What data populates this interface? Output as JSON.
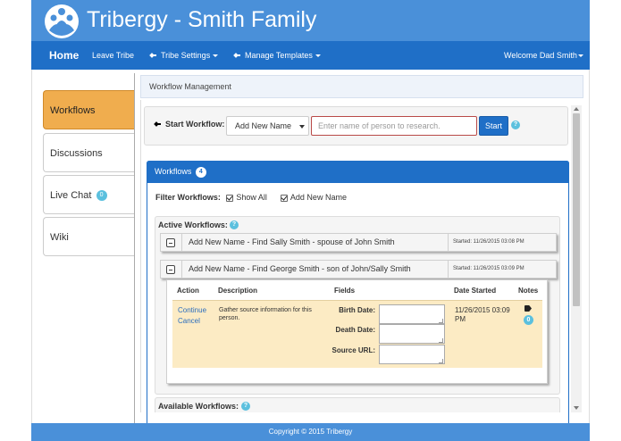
{
  "brand": {
    "title": "Tribergy - Smith Family",
    "logo_icon": "family-group-icon"
  },
  "colors": {
    "brand_bar": "#4a90d9",
    "navbar": "#1f6fc7",
    "active_tab": "#f0ad4e",
    "badge": "#5bc0de",
    "task_highlight": "#fcebc4",
    "link": "#2a6dbd"
  },
  "nav": {
    "home": "Home",
    "leave_tribe": "Leave Tribe",
    "tribe_settings": "Tribe Settings",
    "manage_templates": "Manage Templates",
    "welcome": "Welcome Dad Smith"
  },
  "sidebar": {
    "items": [
      {
        "label": "Workflows",
        "active": true
      },
      {
        "label": "Discussions",
        "active": false
      },
      {
        "label": "Live Chat",
        "badge": "0",
        "active": false
      },
      {
        "label": "Wiki",
        "active": false
      }
    ]
  },
  "content": {
    "header": "Workflow Management"
  },
  "start_workflow": {
    "label": "Start Workflow:",
    "selected": "Add New Name",
    "placeholder": "Enter name of person to research.",
    "button": "Start",
    "help": "?"
  },
  "workflows": {
    "title": "Workflows",
    "count": "4",
    "filter_label": "Filter Workflows:",
    "filters": [
      {
        "label": "Show All",
        "checked": true
      },
      {
        "label": "Add New Name",
        "checked": true
      }
    ],
    "active_label": "Active Workflows:",
    "help": "?",
    "rows": [
      {
        "title": "Add New Name - Find Sally Smith - spouse of John Smith",
        "started": "Started: 11/26/2015 03:08 PM"
      },
      {
        "title": "Add New Name - Find George Smith - son of John/Sally Smith",
        "started": "Started: 11/26/2015 03:09 PM"
      }
    ],
    "detail": {
      "columns": [
        "Action",
        "Description",
        "Fields",
        "Date Started",
        "Notes"
      ],
      "task": {
        "actions": [
          "Continue",
          "Cancel"
        ],
        "description": "Gather source information for this person.",
        "fields": [
          "Birth Date:",
          "Death Date:",
          "Source URL:"
        ],
        "date_started": "11/26/2015 03:09 PM",
        "notes_icon": "tag-icon",
        "notes_count": "0"
      }
    },
    "available_label": "Available Workflows:"
  },
  "footer": {
    "text": "Copyright © 2015 Tribergy"
  }
}
